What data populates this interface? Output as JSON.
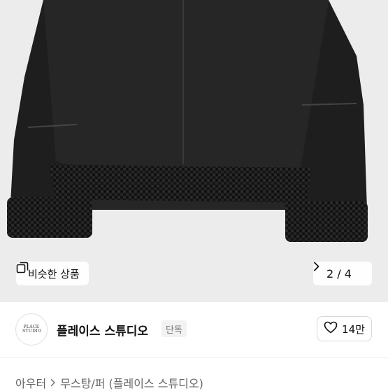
{
  "hero": {
    "similar_label": "비슷한 상품",
    "counter_current": "2",
    "counter_separator": "/",
    "counter_total": "4"
  },
  "shop": {
    "logo_lines": [
      "PLACE",
      "STUDIO"
    ],
    "name": "플레이스 스튜디오",
    "badge": "단독",
    "likes": "14만"
  },
  "breadcrumb": {
    "items": [
      "아우터",
      "무스탕/퍼 (플레이스 스튜디오)"
    ]
  },
  "colors": {
    "hero_background": "#ececec",
    "jacket": "#1f1f1f",
    "shearling": "#0f0f0f"
  },
  "icons": {
    "similar": "overlapping-squares-icon",
    "next": "chevron-right-icon",
    "like": "heart-outline-icon",
    "breadcrumb_sep": "chevron-right-icon"
  }
}
